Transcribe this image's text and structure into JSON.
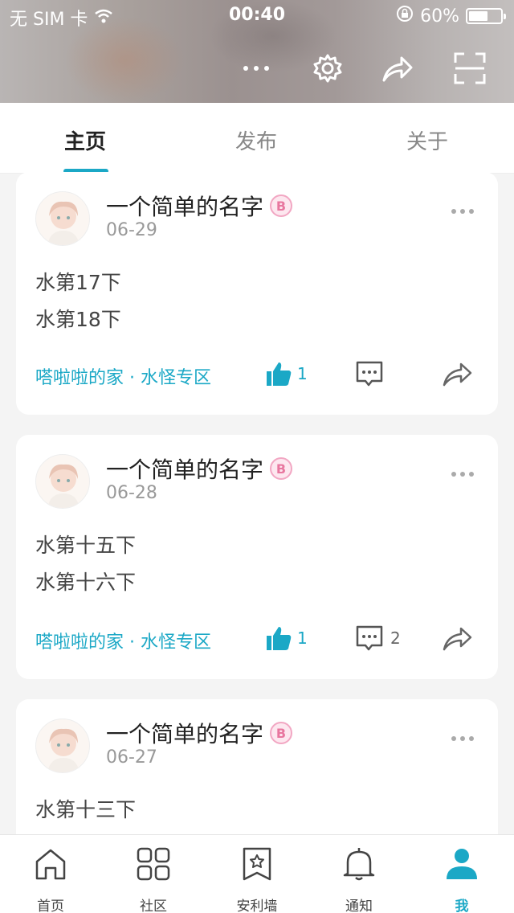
{
  "status_bar": {
    "carrier": "无 SIM 卡",
    "time": "00:40",
    "battery": "60%",
    "battery_level": 0.6
  },
  "header": {
    "icons": [
      "more-icon",
      "settings-icon",
      "share-icon",
      "scan-icon"
    ]
  },
  "tabs": [
    {
      "label": "主页",
      "active": true
    },
    {
      "label": "发布",
      "active": false
    },
    {
      "label": "关于",
      "active": false
    }
  ],
  "posts": [
    {
      "username": "一个简单的名字",
      "date": "06-29",
      "lines": [
        "水第17下",
        "水第18下"
      ],
      "tag": "嗒啦啦的家 · 水怪专区",
      "likes": "1",
      "comments": ""
    },
    {
      "username": "一个简单的名字",
      "date": "06-28",
      "lines": [
        "水第十五下",
        "水第十六下"
      ],
      "tag": "嗒啦啦的家 · 水怪专区",
      "likes": "1",
      "comments": "2"
    },
    {
      "username": "一个简单的名字",
      "date": "06-27",
      "lines": [
        "水第十三下"
      ],
      "tag": "",
      "likes": "",
      "comments": ""
    }
  ],
  "bottom_nav": [
    {
      "label": "首页",
      "icon": "home-icon",
      "active": false
    },
    {
      "label": "社区",
      "icon": "grid-icon",
      "active": false
    },
    {
      "label": "安利墙",
      "icon": "bookmark-star-icon",
      "active": false
    },
    {
      "label": "通知",
      "icon": "bell-icon",
      "active": false
    },
    {
      "label": "我",
      "icon": "user-icon",
      "active": true
    }
  ],
  "colors": {
    "accent": "#1ba8c6",
    "badge": "#e8779f"
  }
}
